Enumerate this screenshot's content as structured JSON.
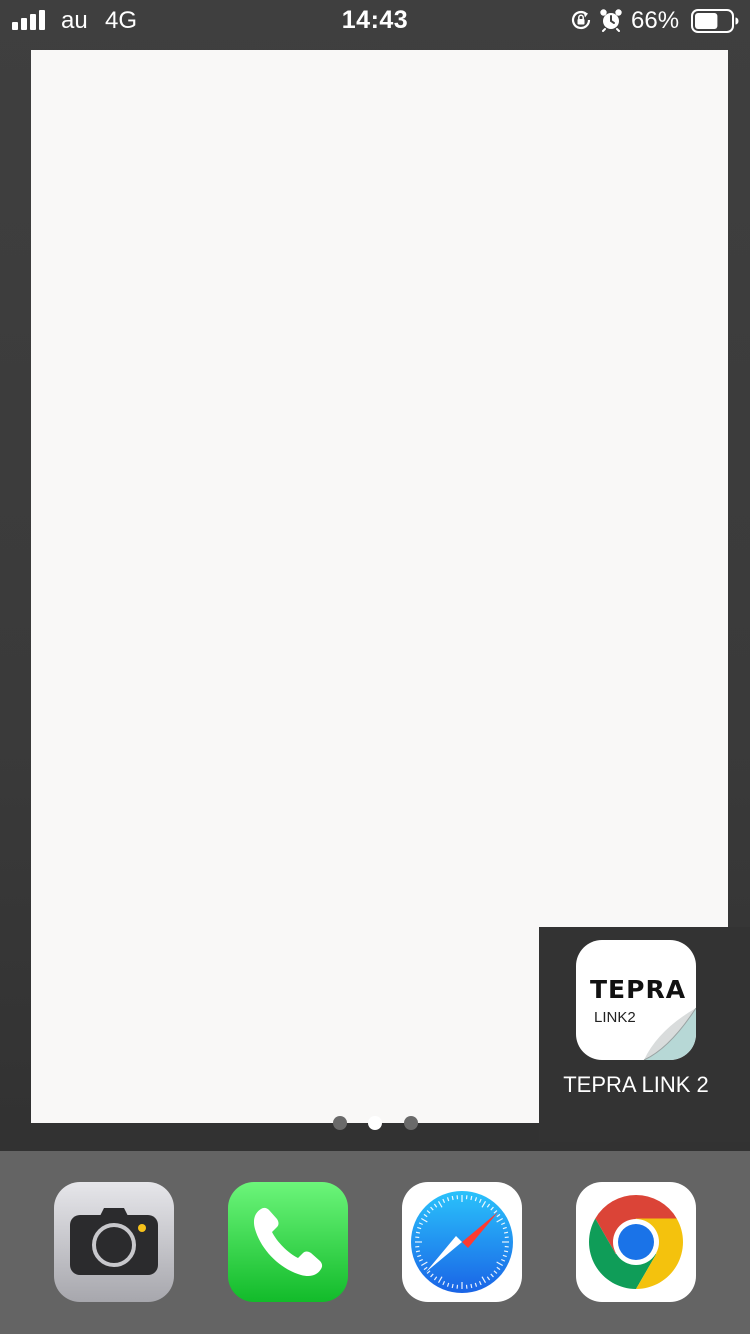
{
  "status_bar": {
    "carrier": "au",
    "network": "4G",
    "time": "14:43",
    "battery_percent": "66%",
    "battery_level": 0.66,
    "signal_bars": 4,
    "icons": [
      "rotation-lock-icon",
      "alarm-icon",
      "battery-icon"
    ]
  },
  "home_screen": {
    "apps": [
      {
        "name": "TEPRA LINK 2",
        "icon": "tepra-link-2-icon",
        "logo_text": "TEPRA",
        "logo_subtext": "LINK2"
      }
    ],
    "page_indicator": {
      "pages": 3,
      "current": 2
    }
  },
  "dock": {
    "apps": [
      {
        "icon": "camera-icon",
        "app": "Camera"
      },
      {
        "icon": "phone-icon",
        "app": "Phone"
      },
      {
        "icon": "safari-icon",
        "app": "Safari"
      },
      {
        "icon": "chrome-icon",
        "app": "Chrome"
      }
    ]
  },
  "colors": {
    "panel_background": "#f9f8f7",
    "dock_background": "#646464",
    "phone_green": "#2dd54b",
    "safari_blue": "#1e7ef0",
    "camera_yellow": "#f7c21b"
  }
}
